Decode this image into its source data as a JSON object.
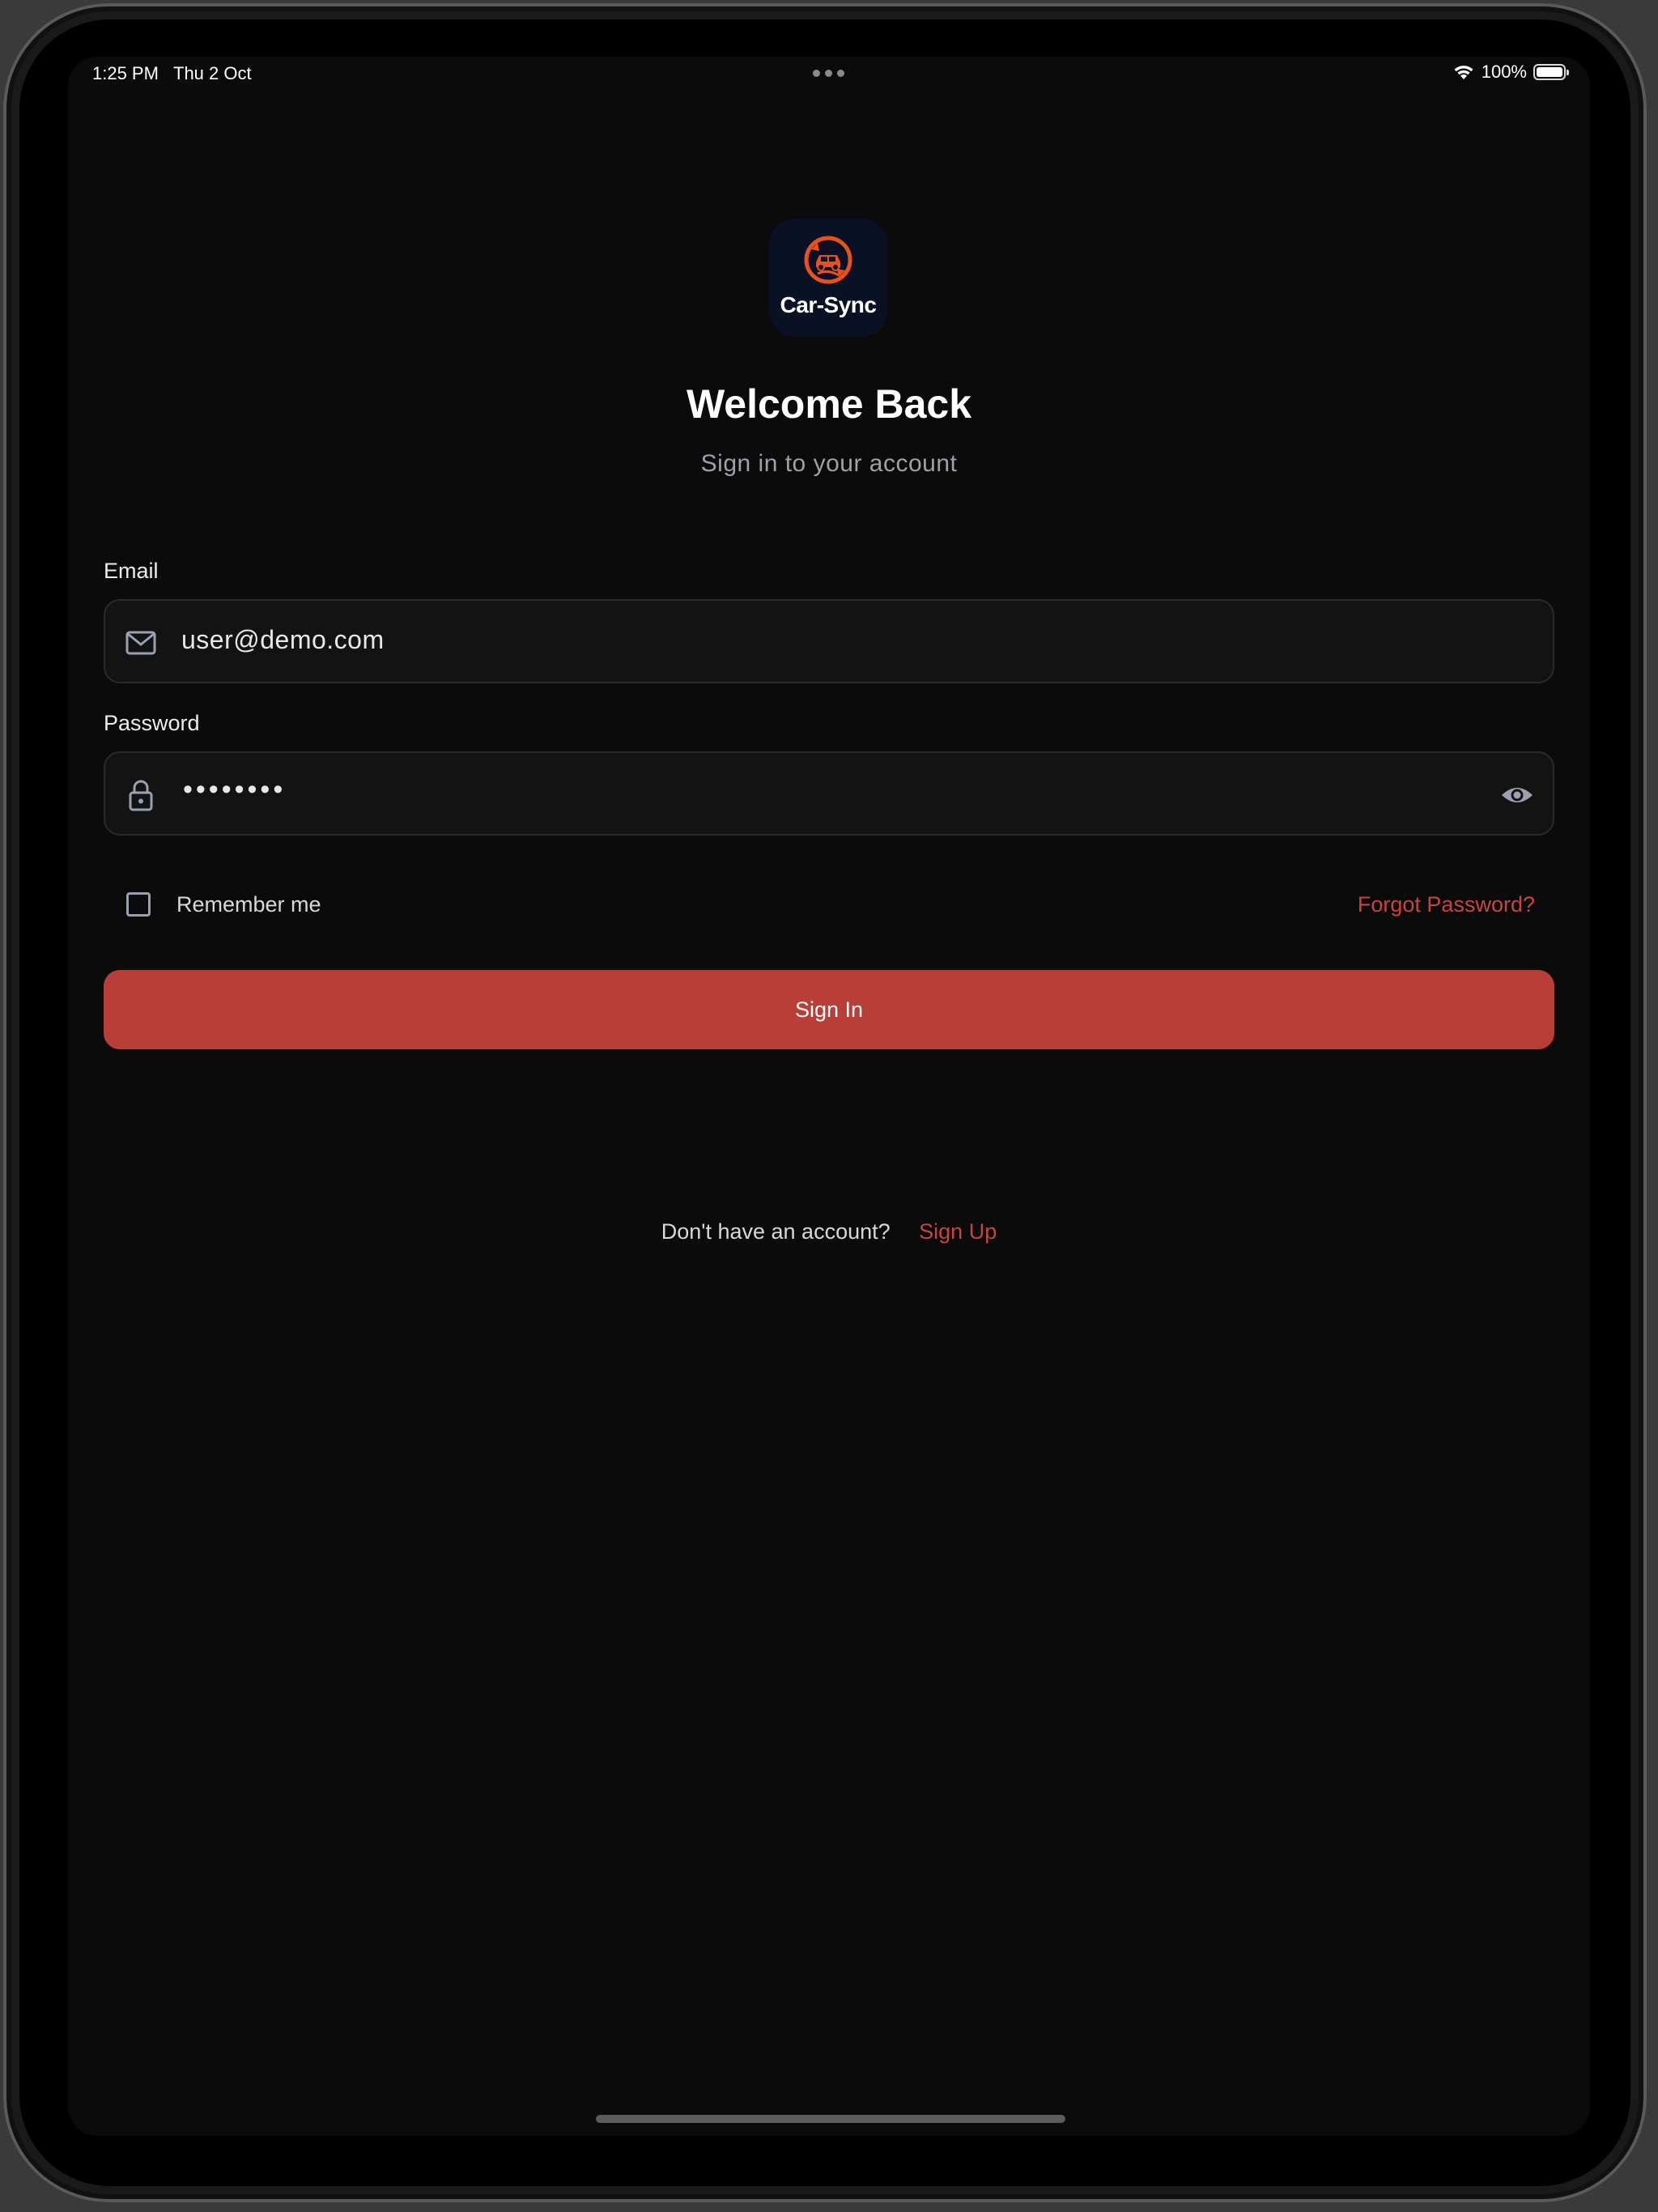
{
  "status_bar": {
    "time": "1:25 PM",
    "date": "Thu 2 Oct",
    "battery_percent": "100%"
  },
  "logo": {
    "text": "Car-Sync",
    "emblem_color": "#e8501e",
    "background_color": "#0a1124"
  },
  "header": {
    "title": "Welcome Back",
    "subtitle": "Sign in to your account"
  },
  "form": {
    "email": {
      "label": "Email",
      "value": "user@demo.com",
      "icon": "mail-icon"
    },
    "password": {
      "label": "Password",
      "masked_value": "••••••••",
      "icon": "lock-icon",
      "toggle_icon": "eye-icon"
    },
    "remember_me": {
      "label": "Remember me",
      "checked": false
    },
    "forgot_password": "Forgot Password?",
    "submit_label": "Sign In"
  },
  "footer": {
    "prompt": "Don't have an account?",
    "link": "Sign Up"
  },
  "colors": {
    "accent": "#b93e38",
    "link": "#c8453e",
    "background": "#0b0b0b",
    "input_background": "#131314"
  }
}
